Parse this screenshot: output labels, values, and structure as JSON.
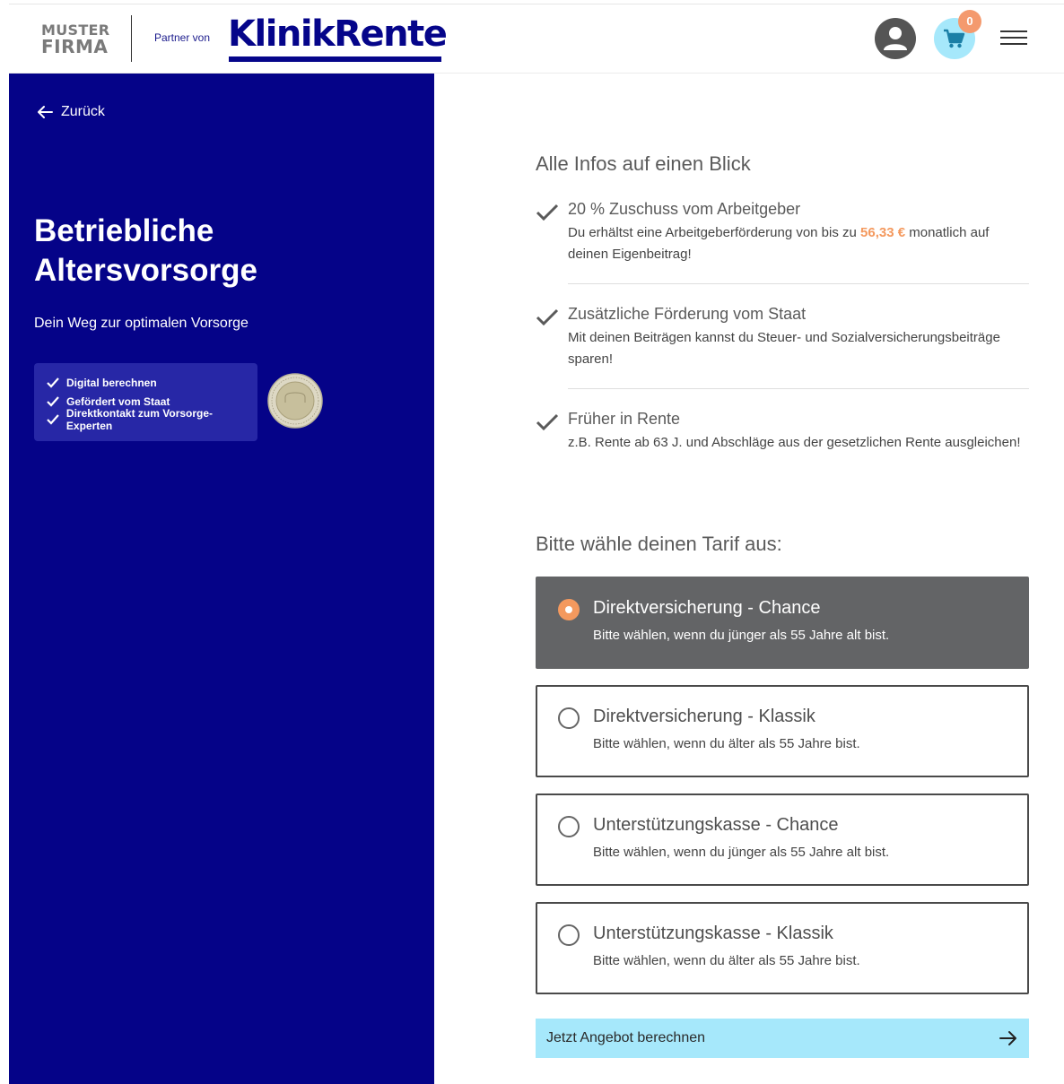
{
  "header": {
    "logo_line1": "MUSTER",
    "logo_line2": "FIRMA",
    "partner_text": "Partner von",
    "brand": "KlinikRente",
    "cart_count": "0",
    "brand_color": "#05058a"
  },
  "left": {
    "back_label": "Zurück",
    "title": "Betriebliche Altersvorsorge",
    "subtitle": "Dein Weg zur optimalen Vorsorge",
    "features": [
      "Digital berechnen",
      "Gefördert vom Staat",
      "Direktkontakt zum Vorsorge-Experten"
    ],
    "panel_color": "#050388"
  },
  "info": {
    "heading": "Alle Infos auf einen Blick",
    "items": [
      {
        "title": "20 % Zuschuss vom Arbeitgeber",
        "desc_pre": "Du erhältst eine Arbeitgeberförderung von bis zu ",
        "amount": "56,33 €",
        "desc_post": " monatlich auf deinen Eigenbeitrag!"
      },
      {
        "title": "Zusätzliche Förderung vom Staat",
        "desc": "Mit deinen Beiträgen kannst du Steuer- und Sozialversicherungsbeiträge sparen!"
      },
      {
        "title": "Früher in Rente",
        "desc": "z.B. Rente ab 63 J. und Abschläge aus der gesetzlichen Rente ausgleichen!"
      }
    ]
  },
  "tarif": {
    "heading": "Bitte wähle deinen Tarif aus:",
    "options": [
      {
        "title": "Direktversicherung - Chance",
        "desc": "Bitte wählen, wenn du jünger als 55 Jahre alt bist.",
        "selected": true
      },
      {
        "title": "Direktversicherung - Klassik",
        "desc": "Bitte wählen, wenn du älter als 55 Jahre bist.",
        "selected": false
      },
      {
        "title": "Unterstützungskasse - Chance",
        "desc": "Bitte wählen, wenn du jünger als 55 Jahre alt bist.",
        "selected": false
      },
      {
        "title": "Unterstützungskasse - Klassik",
        "desc": "Bitte wählen, wenn du älter als 55 Jahre bist.",
        "selected": false
      }
    ],
    "accent_color": "#f4995e"
  },
  "cta": {
    "label": "Jetzt Angebot berechnen",
    "color": "#a6e8fb"
  }
}
